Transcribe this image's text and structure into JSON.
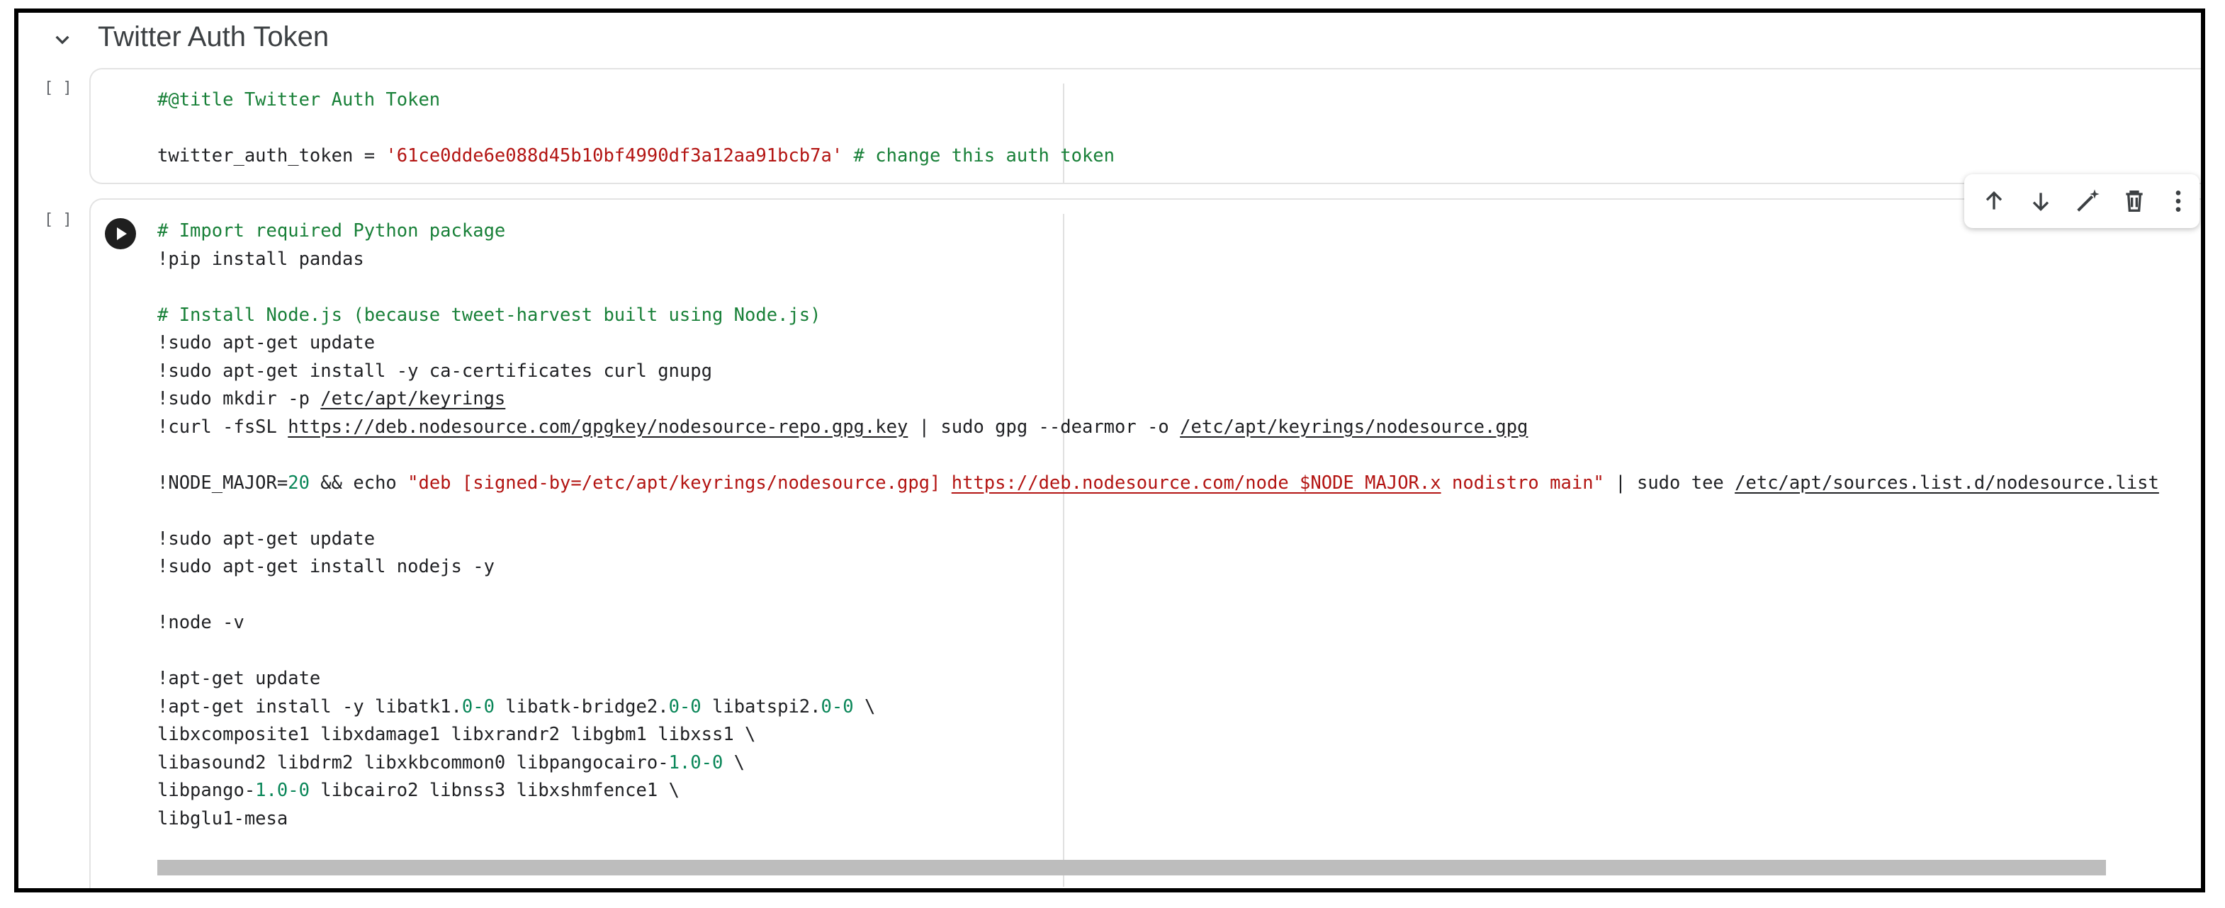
{
  "section": {
    "title": "Twitter Auth Token"
  },
  "cells": [
    {
      "exec_count": "[ ]"
    },
    {
      "exec_count": "[ ]"
    }
  ],
  "toolbar": {
    "move_up_icon": "arrow-up-icon",
    "move_down_icon": "arrow-down-icon",
    "edit_icon": "magic-wand-icon",
    "delete_icon": "trash-icon",
    "more_icon": "more-vert-icon"
  },
  "code1": {
    "l1": "#@title Twitter Auth Token",
    "l2_a": "twitter_auth_token = ",
    "l2_b": "'61ce0dde6e088d45b10bf4990df3a12aa91bcb7a'",
    "l2_c": " # change this auth token"
  },
  "code2": {
    "l1": "# Import required Python package",
    "l2": "!pip install pandas",
    "l3": "# Install Node.js (because tweet-harvest built using Node.js)",
    "l4": "!sudo apt-get update",
    "l5": "!sudo apt-get install -y ca-certificates curl gnupg",
    "l6_a": "!sudo mkdir -p ",
    "l6_b": "/etc/apt/keyrings",
    "l7_a": "!curl -fsSL ",
    "l7_b": "https://deb.nodesource.com/gpgkey/nodesource-repo.gpg.key",
    "l7_c": " | sudo gpg --dearmor -o ",
    "l7_d": "/etc/apt/keyrings/nodesource.gpg",
    "l8_a": "!NODE_MAJOR=",
    "l8_b": "20",
    "l8_c": " && echo ",
    "l8_d": "\"deb [signed-by=/etc/apt/keyrings/nodesource.gpg] ",
    "l8_e": "https://deb.nodesource.com/node_$NODE_MAJOR.x",
    "l8_f": " nodistro main\"",
    "l8_g": " | sudo tee ",
    "l8_h": "/etc/apt/sources.list.d/nodesource.list",
    "l9": "!sudo apt-get update",
    "l10": "!sudo apt-get install nodejs -y",
    "l11": "!node -v",
    "l12": "!apt-get update",
    "l13_a": "!apt-get install -y libatk1.",
    "l13_b": "0-0",
    "l13_c": " libatk-bridge2.",
    "l13_d": "0-0",
    "l13_e": " libatspi2.",
    "l13_f": "0-0",
    "l13_g": " \\",
    "l14": "libxcomposite1 libxdamage1 libxrandr2 libgbm1 libxss1 \\",
    "l15_a": "libasound2 libdrm2 libxkbcommon0 libpangocairo-",
    "l15_b": "1.0-0",
    "l15_c": " \\",
    "l16_a": "libpango-",
    "l16_b": "1.0-0",
    "l16_c": " libcairo2 libnss3 libxshmfence1 \\",
    "l17": "libglu1-mesa"
  }
}
